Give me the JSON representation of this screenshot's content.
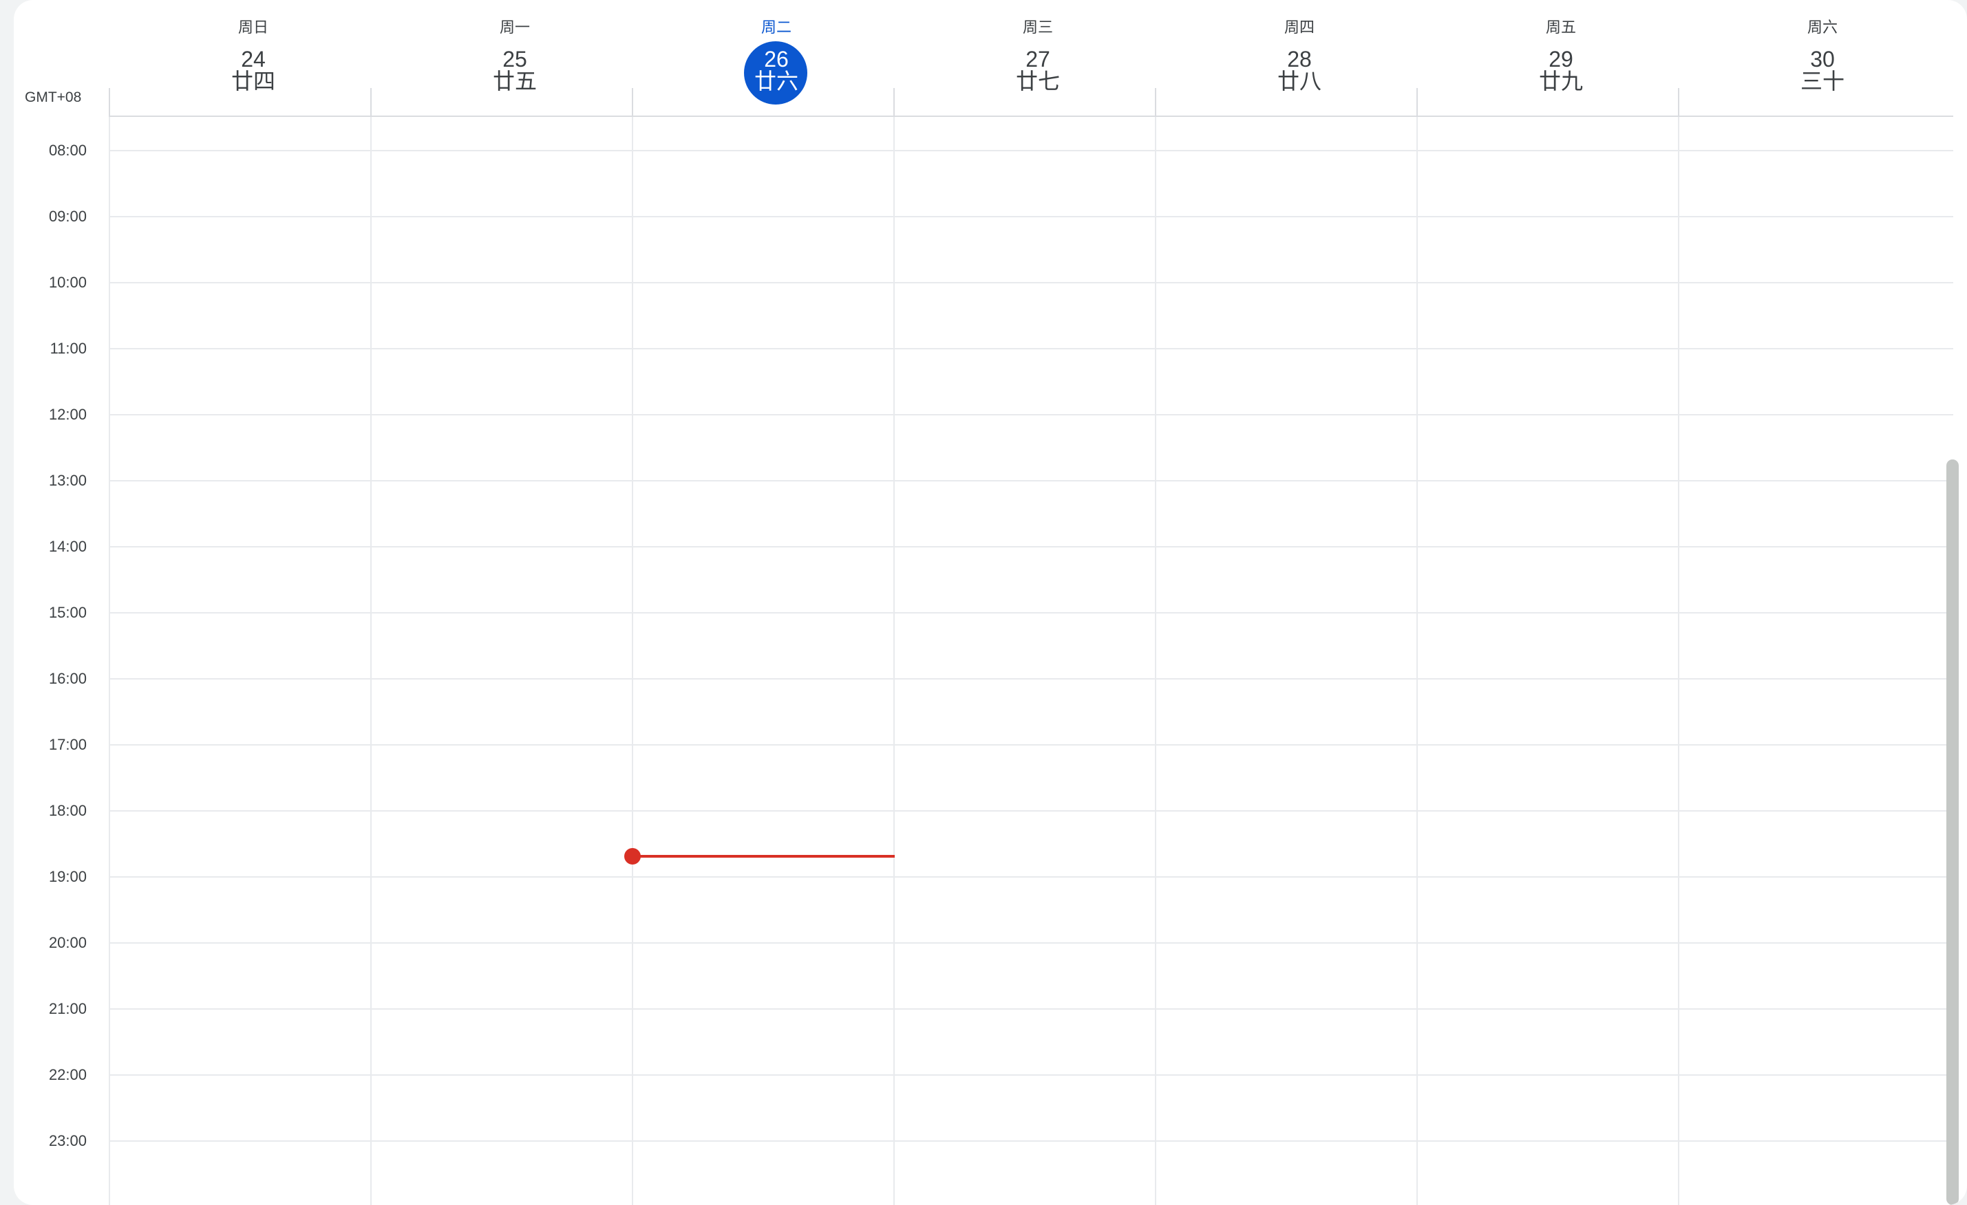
{
  "timezone": "GMT+08",
  "days": [
    {
      "dow": "周日",
      "num": "24",
      "lunar": "廿四"
    },
    {
      "dow": "周一",
      "num": "25",
      "lunar": "廿五"
    },
    {
      "dow": "周二",
      "num": "26",
      "lunar": "廿六",
      "today": true
    },
    {
      "dow": "周三",
      "num": "27",
      "lunar": "廿七"
    },
    {
      "dow": "周四",
      "num": "28",
      "lunar": "廿八"
    },
    {
      "dow": "周五",
      "num": "29",
      "lunar": "廿九"
    },
    {
      "dow": "周六",
      "num": "30",
      "lunar": "三十"
    }
  ],
  "hours": [
    "08:00",
    "09:00",
    "10:00",
    "11:00",
    "12:00",
    "13:00",
    "14:00",
    "15:00",
    "16:00",
    "17:00",
    "18:00",
    "19:00",
    "20:00",
    "21:00",
    "22:00",
    "23:00"
  ],
  "current_time_indicator": {
    "day": "26"
  },
  "colors": {
    "accent": "#0b57d0",
    "now": "#d93025",
    "grid": "#e8eaed"
  }
}
